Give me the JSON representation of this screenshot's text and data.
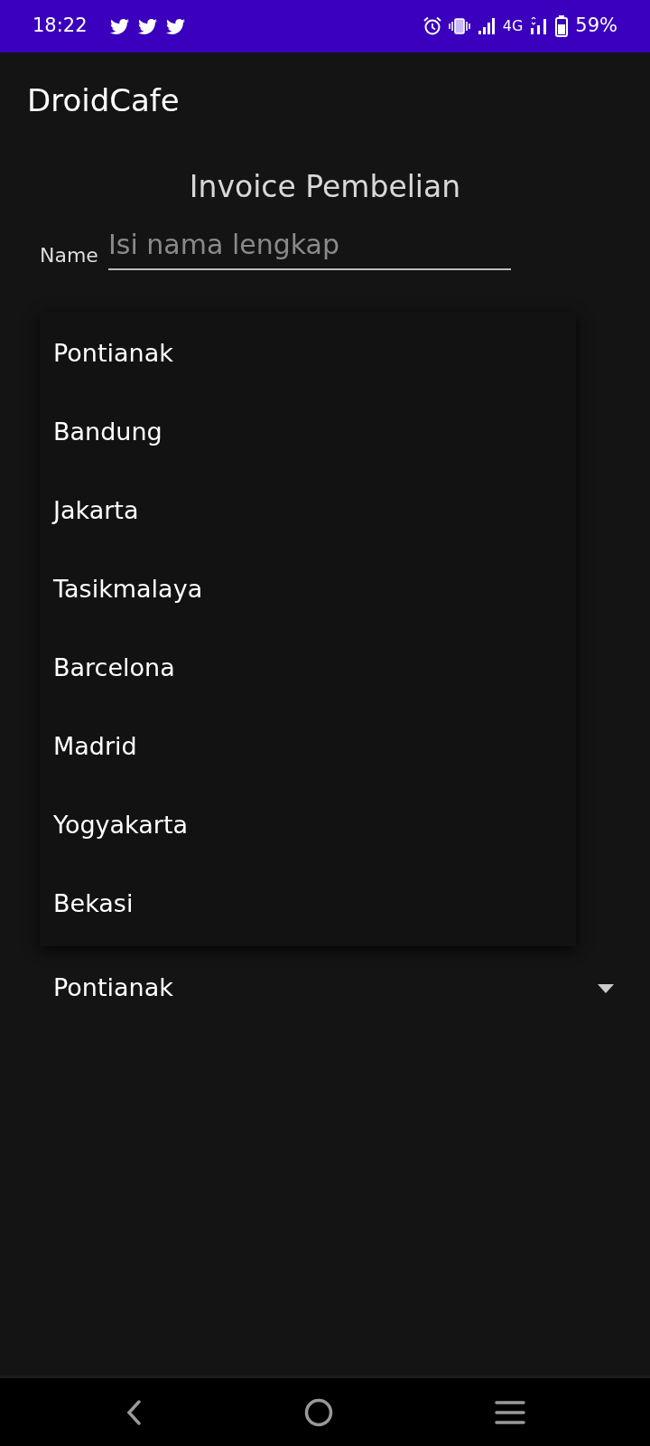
{
  "status_bar": {
    "time": "18:22",
    "network": "4G",
    "battery": "59%"
  },
  "app_bar": {
    "title": "DroidCafe"
  },
  "form": {
    "heading": "Invoice Pembelian",
    "fields": [
      {
        "label": "Name",
        "placeholder": "Isi nama lengkap"
      }
    ],
    "spinner": {
      "value": "Pontianak"
    }
  },
  "dropdown": {
    "items": [
      {
        "label": "Pontianak"
      },
      {
        "label": "Bandung"
      },
      {
        "label": "Jakarta"
      },
      {
        "label": "Tasikmalaya"
      },
      {
        "label": "Barcelona"
      },
      {
        "label": "Madrid"
      },
      {
        "label": "Yogyakarta"
      },
      {
        "label": "Bekasi"
      }
    ]
  }
}
